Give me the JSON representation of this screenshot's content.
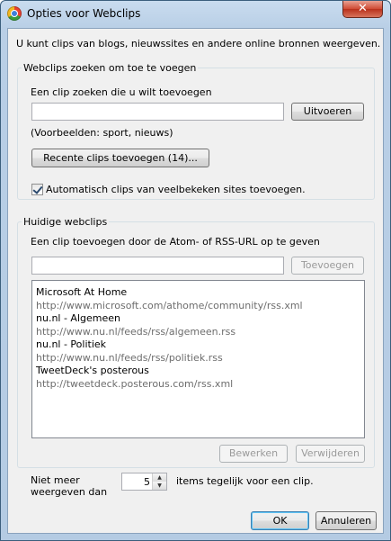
{
  "window": {
    "title": "Opties voor Webclips",
    "close_glyph": "✕"
  },
  "intro_text": "U kunt clips van blogs, nieuwssites en andere online bronnen weergeven.",
  "search_group": {
    "legend": "Webclips zoeken om toe te voegen",
    "search_label": "Een clip zoeken die u wilt toevoegen",
    "search_value": "",
    "run_button": "Uitvoeren",
    "examples": "(Voorbeelden: sport, nieuws)",
    "recent_button": "Recente clips toevoegen (14)...",
    "auto_checkbox_label": "Automatisch clips van veelbekeken sites toevoegen.",
    "auto_checked": true
  },
  "current_group": {
    "legend": "Huidige webclips",
    "add_label": "Een clip toevoegen door de Atom- of RSS-URL op te geven",
    "url_value": "",
    "add_button": "Toevoegen",
    "feeds": [
      {
        "name": "Microsoft At Home",
        "url": "http://www.microsoft.com/athome/community/rss.xml"
      },
      {
        "name": "nu.nl - Algemeen",
        "url": "http://www.nu.nl/feeds/rss/algemeen.rss"
      },
      {
        "name": "nu.nl - Politiek",
        "url": "http://www.nu.nl/feeds/rss/politiek.rss"
      },
      {
        "name": "TweetDeck's posterous",
        "url": "http://tweetdeck.posterous.com/rss.xml"
      }
    ],
    "edit_button": "Bewerken",
    "remove_button": "Verwijderen"
  },
  "display_limit": {
    "prefix_line1": "Niet meer",
    "prefix_line2": "weergeven dan",
    "value": "5",
    "suffix": "items tegelijk voor een clip."
  },
  "footer": {
    "ok_button": "OK",
    "cancel_button": "Annuleren"
  }
}
